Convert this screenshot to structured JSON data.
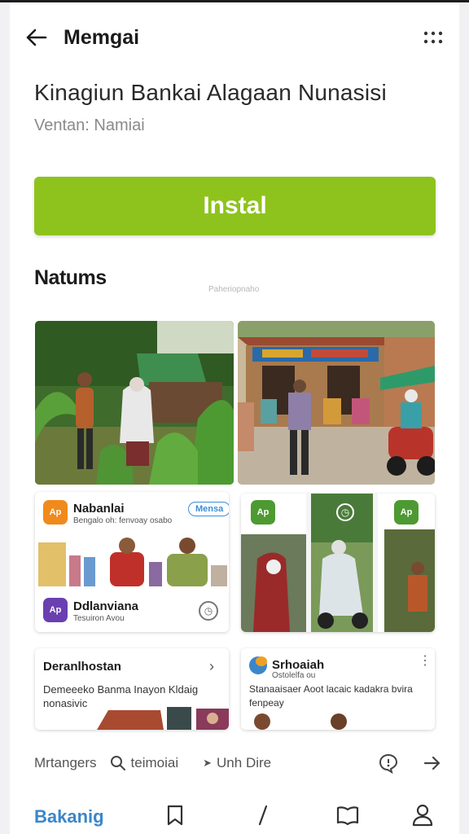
{
  "header": {
    "title": "Memgai"
  },
  "app": {
    "name": "Kinagiun Bankai Alagaan Nunasisi",
    "developer": "Ventan: Namiai"
  },
  "install": {
    "label": "Instal"
  },
  "section": {
    "title": "Natums",
    "caption": "Paheriopnaho"
  },
  "cards": {
    "a": {
      "badge": "Ap",
      "title": "Nabanlai",
      "subtitle": "Bengalo oh: fenvoay osabo",
      "action": "Mensa",
      "footer_badge": "Ap",
      "footer_title": "Ddlanviana",
      "footer_sub": "Tesuiron Avou"
    },
    "b": {
      "badge_1": "Ap",
      "badge_2": "Ap"
    },
    "c": {
      "title": "Deranlhostan",
      "description": "Demeeeko Banma Inayon Kldaig nonasivic"
    },
    "d": {
      "title": "Srhoaiah",
      "subtitle": "Ostolelfa ou",
      "description": "Stanaaisaer Aoot lacaic kadakra bvira fenpeay"
    }
  },
  "links": {
    "one": "Mrtangers",
    "two": "teimoiai",
    "three": "Unh Dire"
  },
  "nav": {
    "label": "Bakanig"
  },
  "colors": {
    "accent": "#8ec31d",
    "link": "#3b86c9"
  }
}
